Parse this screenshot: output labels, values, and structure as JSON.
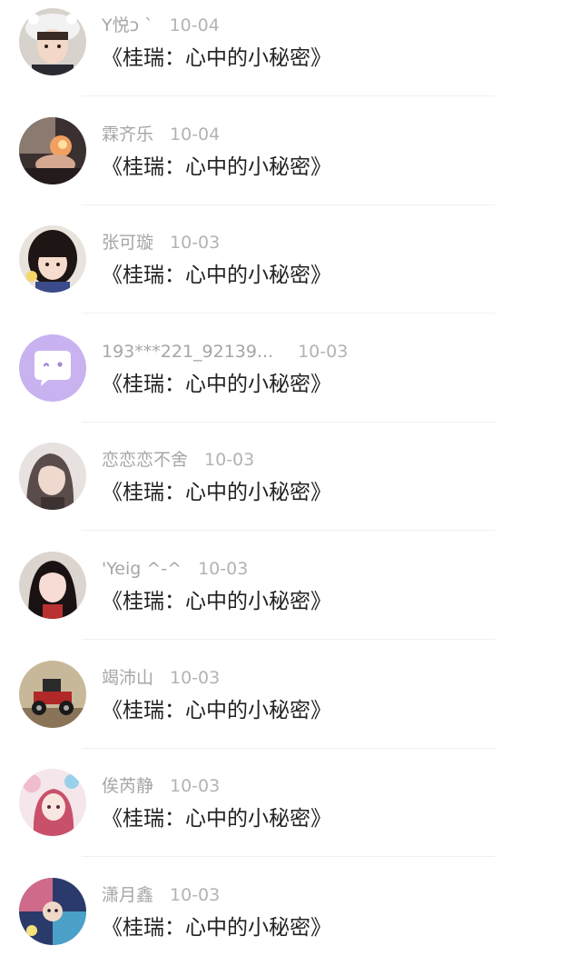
{
  "comments": [
    {
      "user": "Y悦ↄ ˋ",
      "date": "10-04",
      "title": "《桂瑞：心中的小秘密》",
      "avatar_icon": "girl-cap-avatar-icon"
    },
    {
      "user": "霖齐乐",
      "date": "10-04",
      "title": "《桂瑞：心中的小秘密》",
      "avatar_icon": "sparkle-hands-avatar-icon"
    },
    {
      "user": "张可璇",
      "date": "10-03",
      "title": "《桂瑞：心中的小秘密》",
      "avatar_icon": "girl-bangs-avatar-icon"
    },
    {
      "user": "193***221_92139...",
      "date": "10-03",
      "title": "《桂瑞：心中的小秘密》",
      "avatar_icon": "chat-bubble-avatar-icon"
    },
    {
      "user": "恋恋恋不舍",
      "date": "10-03",
      "title": "《桂瑞：心中的小秘密》",
      "avatar_icon": "girl-long-hair-avatar-icon"
    },
    {
      "user": "'Yeig ^-^",
      "date": "10-03",
      "title": "《桂瑞：心中的小秘密》",
      "avatar_icon": "girl-dark-hair-avatar-icon"
    },
    {
      "user": "竭沛山",
      "date": "10-03",
      "title": "《桂瑞：心中的小秘密》",
      "avatar_icon": "toy-car-avatar-icon"
    },
    {
      "user": "俟芮静",
      "date": "10-03",
      "title": "《桂瑞：心中的小秘密》",
      "avatar_icon": "anime-girl-avatar-icon"
    },
    {
      "user": "潇月鑫",
      "date": "10-03",
      "title": "《桂瑞：心中的小秘密》",
      "avatar_icon": "anime-collage-avatar-icon"
    }
  ],
  "colors": {
    "meta_text": "#a6a6a6",
    "title_text": "#222222",
    "divider": "#f0f0f0",
    "default_avatar_bg": "#c8b3f0"
  }
}
